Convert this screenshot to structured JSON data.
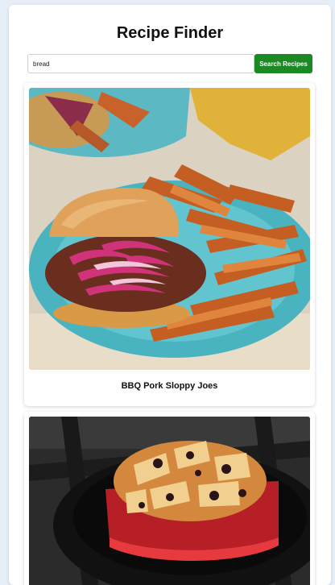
{
  "app": {
    "title": "Recipe Finder"
  },
  "search": {
    "value": "bread",
    "button_label": "Search Recipes"
  },
  "results": [
    {
      "title": "BBQ Pork Sloppy Joes",
      "image": "sloppy-joe-with-sweet-potato-fries-photo"
    },
    {
      "title": "",
      "image": "bread-pudding-in-cast-iron-photo"
    }
  ],
  "colors": {
    "background": "#e6eef7",
    "accent": "#1c8a24"
  }
}
